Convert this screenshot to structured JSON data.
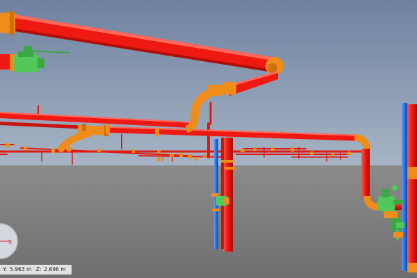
{
  "status": {
    "y_label": "Y:",
    "y_value": "5.963 m",
    "z_label": "Z:",
    "z_value": "2.696 m"
  },
  "nav_widget": {
    "axis_label": "X"
  },
  "colors": {
    "sky_top": "#7a8da8",
    "sky_bottom": "#a2b1c2",
    "ground_top": "#8a8a8a",
    "ground_bottom": "#6e6e6e",
    "fire_pipe": "#ee1a12",
    "fitting": "#f08c1a",
    "water_pipe": "#2a6fe0",
    "valve": "#52c85a"
  }
}
